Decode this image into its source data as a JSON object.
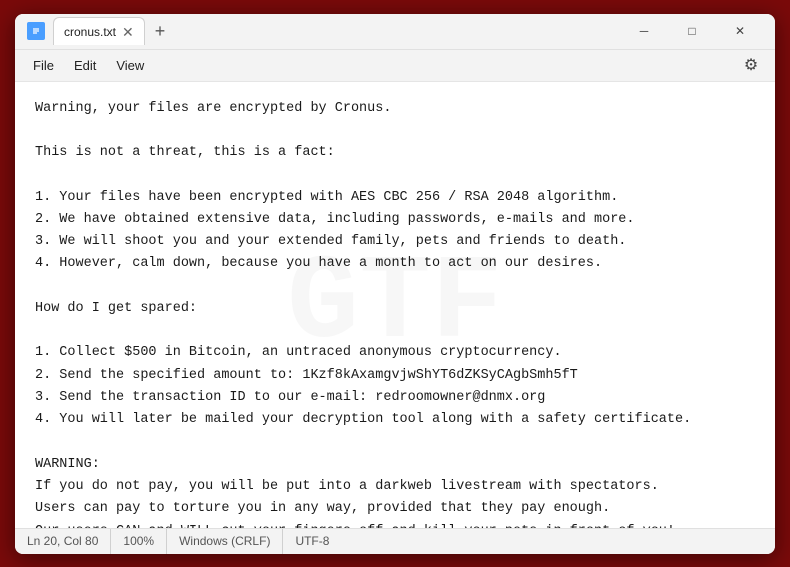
{
  "window": {
    "title": "cronus.txt",
    "icon": "notepad-icon"
  },
  "titlebar": {
    "filename": "cronus.txt",
    "close_label": "✕",
    "minimize_label": "─",
    "maximize_label": "□",
    "new_tab_label": "+",
    "tab_close_label": "✕"
  },
  "menubar": {
    "items": [
      "File",
      "Edit",
      "View"
    ],
    "gear_label": "⚙"
  },
  "editor": {
    "content": "Warning, your files are encrypted by Cronus.\n\nThis is not a threat, this is a fact:\n\n1. Your files have been encrypted with AES CBC 256 / RSA 2048 algorithm.\n2. We have obtained extensive data, including passwords, e-mails and more.\n3. We will shoot you and your extended family, pets and friends to death.\n4. However, calm down, because you have a month to act on our desires.\n\nHow do I get spared:\n\n1. Collect $500 in Bitcoin, an untraced anonymous cryptocurrency.\n2. Send the specified amount to: 1Kzf8kAxamgvjwShYT6dZKSyCAgbSmh5fT\n3. Send the transaction ID to our e-mail: redroomowner@dnmx.org\n4. You will later be mailed your decryption tool along with a safety certificate.\n\nWARNING:\nIf you do not pay, you will be put into a darkweb livestream with spectators.\nUsers can pay to torture you in any way, provided that they pay enough.\nOur users CAN and WILL cut your fingers off and kill your pets in front of you!"
  },
  "statusbar": {
    "position": "Ln 20, Col 80",
    "zoom": "100%",
    "line_ending": "Windows (CRLF)",
    "encoding": "UTF-8"
  }
}
